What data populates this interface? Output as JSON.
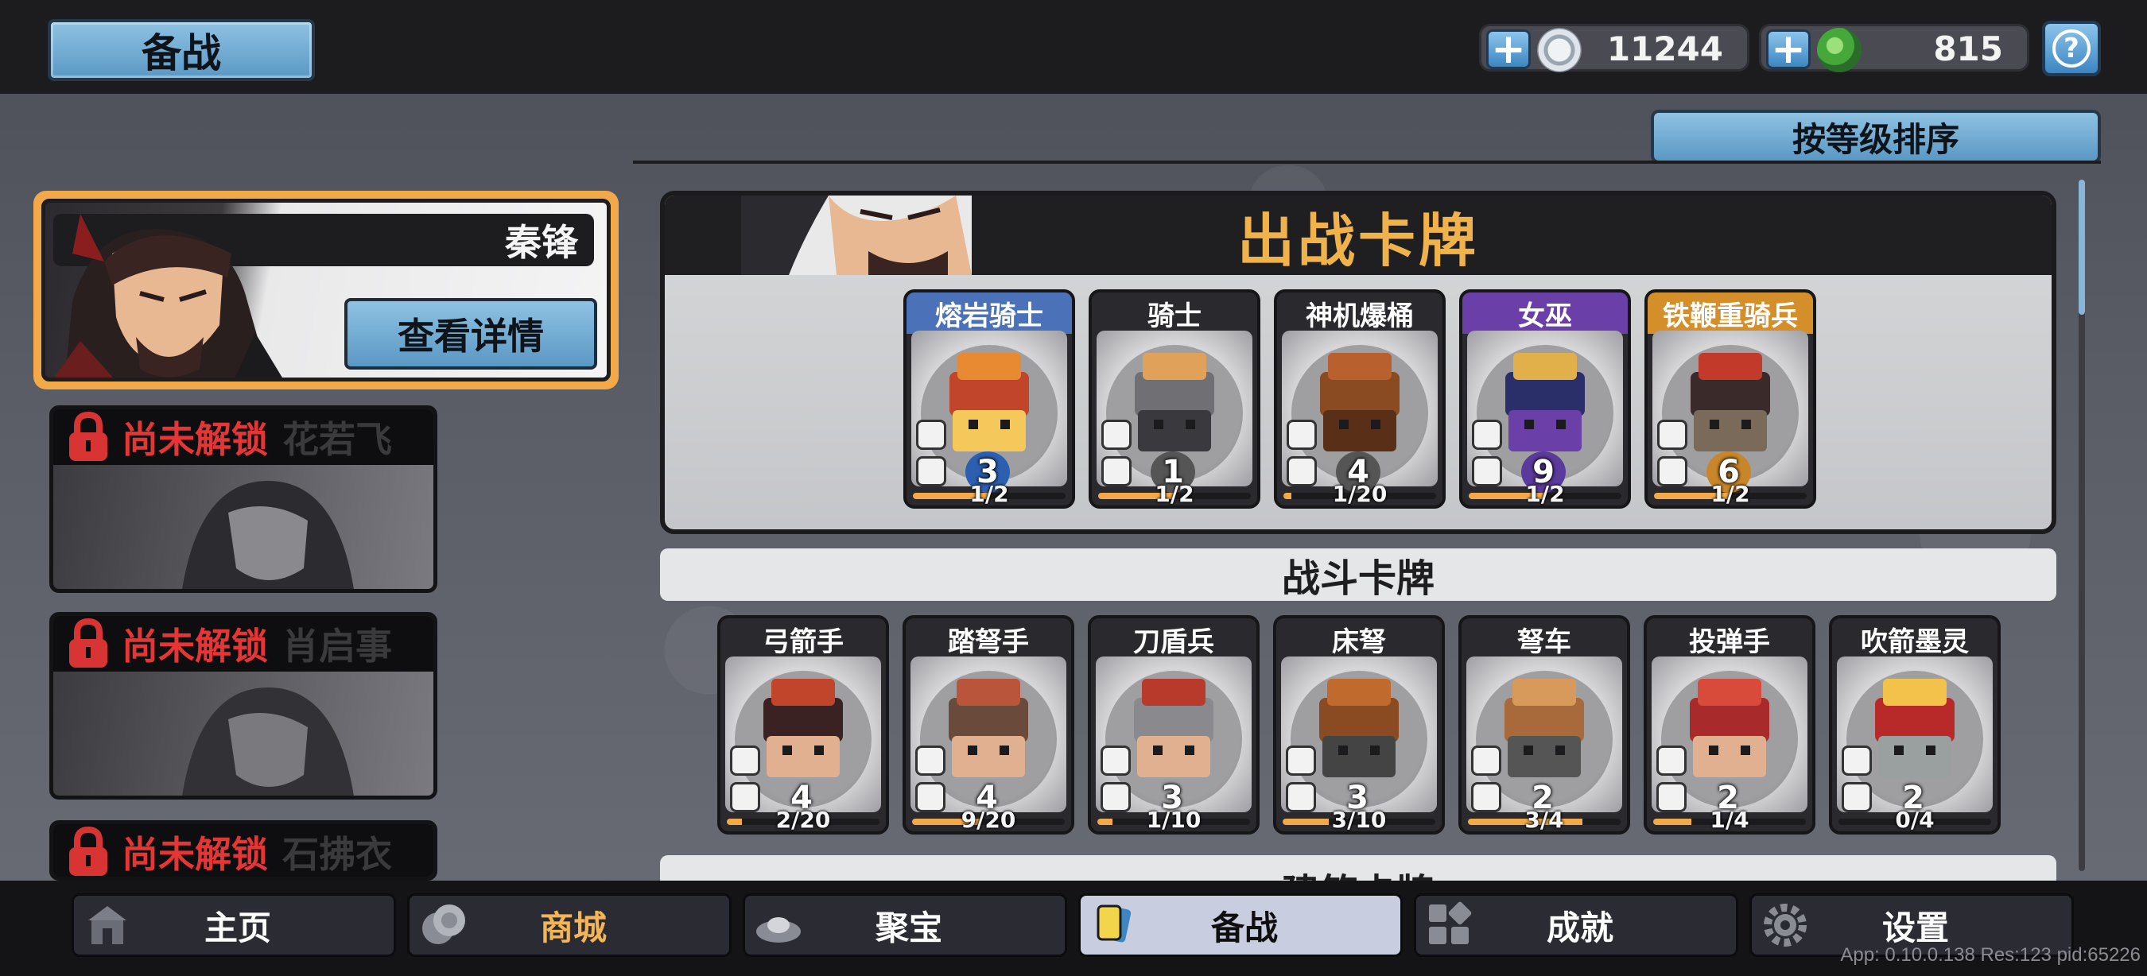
{
  "header": {
    "title": "备战",
    "silver": {
      "value": "11244",
      "plus": "+"
    },
    "jade": {
      "value": "815",
      "plus": "+"
    },
    "help": "?"
  },
  "sort_button": "按等级排序",
  "heroes": {
    "selected": {
      "name": "秦锋",
      "detail_button": "查看详情"
    },
    "locked": [
      {
        "status": "尚未解锁",
        "name": "花若飞"
      },
      {
        "status": "尚未解锁",
        "name": "肖启事"
      },
      {
        "status": "尚未解锁",
        "name": "石拂衣"
      }
    ]
  },
  "deploy": {
    "title": "出战卡牌",
    "cards": [
      {
        "name": "熔岩骑士",
        "level": "3",
        "count": "1/2",
        "progress": 0.5,
        "head_color": "#4b72b8",
        "badge_color": "#2d5fb0"
      },
      {
        "name": "骑士",
        "level": "1",
        "count": "1/2",
        "progress": 0.5,
        "head_color": "#2a2a2e",
        "badge_color": "#555"
      },
      {
        "name": "神机爆桶",
        "level": "4",
        "count": "1/20",
        "progress": 0.05,
        "head_color": "#2a2a2e",
        "badge_color": "#555"
      },
      {
        "name": "女巫",
        "level": "9",
        "count": "1/2",
        "progress": 0.5,
        "head_color": "#6a3fa8",
        "badge_color": "#5a3a9a"
      },
      {
        "name": "铁鞭重骑兵",
        "level": "6",
        "count": "1/2",
        "progress": 0.5,
        "head_color": "#d58f2a",
        "badge_color": "#c7862a"
      }
    ]
  },
  "battle": {
    "title": "战斗卡牌",
    "cards": [
      {
        "name": "弓箭手",
        "level": "4",
        "count": "2/20",
        "progress": 0.1
      },
      {
        "name": "踏弩手",
        "level": "4",
        "count": "9/20",
        "progress": 0.45
      },
      {
        "name": "刀盾兵",
        "level": "3",
        "count": "1/10",
        "progress": 0.1
      },
      {
        "name": "床弩",
        "level": "3",
        "count": "3/10",
        "progress": 0.3
      },
      {
        "name": "弩车",
        "level": "2",
        "count": "3/4",
        "progress": 0.75
      },
      {
        "name": "投弹手",
        "level": "2",
        "count": "1/4",
        "progress": 0.25
      },
      {
        "name": "吹箭墨灵",
        "level": "2",
        "count": "0/4",
        "progress": 0.0
      }
    ]
  },
  "building": {
    "title": "建筑卡牌"
  },
  "nav": [
    {
      "label": "主页",
      "icon": "home-icon"
    },
    {
      "label": "商城",
      "icon": "shop-coins-icon"
    },
    {
      "label": "聚宝",
      "icon": "treasure-bowl-icon"
    },
    {
      "label": "备战",
      "icon": "cards-icon"
    },
    {
      "label": "成就",
      "icon": "achievement-grid-icon"
    },
    {
      "label": "设置",
      "icon": "gear-icon"
    }
  ],
  "debug": "App: 0.10.0.138 Res:123 pid:65226"
}
